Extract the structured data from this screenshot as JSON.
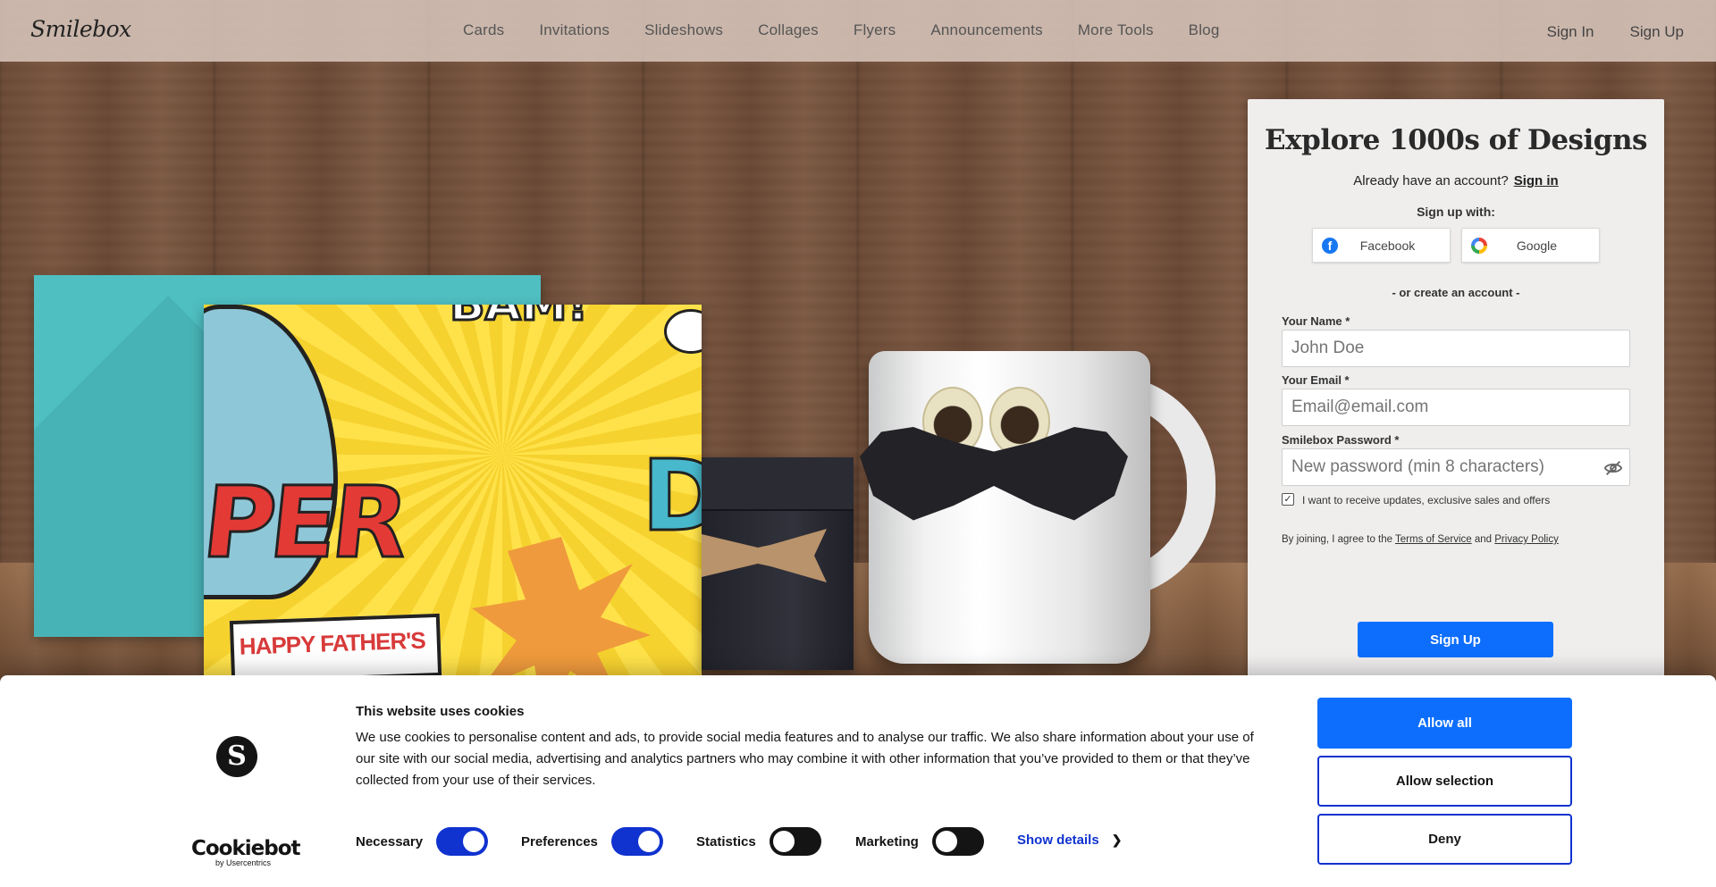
{
  "header": {
    "logo": "Smilebox",
    "nav": [
      "Cards",
      "Invitations",
      "Slideshows",
      "Collages",
      "Flyers",
      "Announcements",
      "More Tools",
      "Blog"
    ],
    "sign_in": "Sign In",
    "sign_up": "Sign Up"
  },
  "hero": {
    "card_text_per": "PER",
    "card_text_da": "DA",
    "card_text_bam": "BAM!",
    "card_banner": "HAPPY FATHER'S"
  },
  "signup": {
    "title": "Explore 1000s of Designs",
    "have_account": "Already have an account?",
    "sign_in_link": "Sign in",
    "sign_up_with": "Sign up with:",
    "facebook": "Facebook",
    "google": "Google",
    "or_create": "- or create an account -",
    "name_label": "Your Name *",
    "name_placeholder": "John Doe",
    "email_label": "Your Email *",
    "email_placeholder": "Email@email.com",
    "password_label": "Smilebox Password *",
    "password_placeholder": "New password (min 8 characters)",
    "updates_label": "I want to receive updates, exclusive sales and offers",
    "updates_checked": true,
    "terms_prefix": "By joining, I agree to the",
    "terms_link": "Terms of Service",
    "terms_and": "and",
    "privacy_link": "Privacy Policy",
    "submit": "Sign Up"
  },
  "cookie": {
    "logo_letter": "S",
    "brand": "Cookiebot",
    "brand_by": "by Usercentrics",
    "title": "This website uses cookies",
    "text": "We use cookies to personalise content and ads, to provide social media features and to analyse our traffic. We also share information about your use of our site with our social media, advertising and analytics partners who may combine it with other information that you’ve provided to them or that they’ve collected from your use of their services.",
    "toggles": [
      {
        "label": "Necessary",
        "on": true
      },
      {
        "label": "Preferences",
        "on": true
      },
      {
        "label": "Statistics",
        "on": false
      },
      {
        "label": "Marketing",
        "on": false
      }
    ],
    "show_details": "Show details",
    "allow_all": "Allow all",
    "allow_selection": "Allow selection",
    "deny": "Deny"
  },
  "colors": {
    "primary_button": "#0d6efd",
    "cookie_accent": "#1032cf",
    "header_bg": "#d6c4ba"
  }
}
